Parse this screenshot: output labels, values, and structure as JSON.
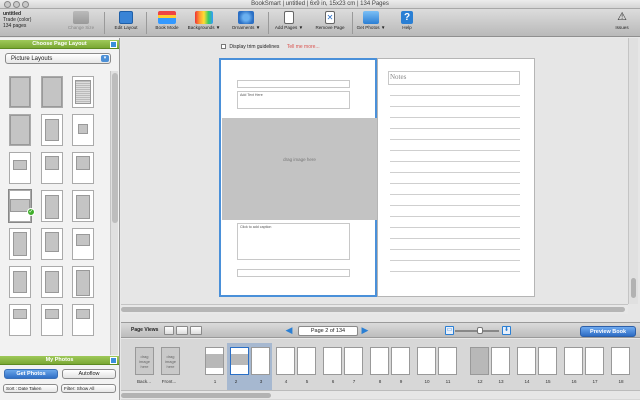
{
  "window": {
    "title": "BookSmart  |  untitled  |  6x9 in, 15x23 cm  |  134 Pages"
  },
  "project": {
    "name": "untitled",
    "cover": "Trade (color)",
    "pages": "134 pages"
  },
  "toolbar": {
    "change_size": "Change Size",
    "edit_layout": "Edit Layout",
    "book_mode": "Book Mode",
    "backgrounds": "Backgrounds ▼",
    "ornaments": "Ornaments ▼",
    "add_pages": "Add Pages ▼",
    "remove_page": "Remove Page",
    "get_photos": "Get Photos ▼",
    "help": "Help",
    "issues": "Issues"
  },
  "left_panel": {
    "header": "Choose Page Layout",
    "layout_select": "Picture Layouts",
    "photos_header": "My Photos",
    "get_photos_btn": "Get Photos",
    "autoflow_btn": "Autoflow",
    "sort_select": "Sort : Date Taken",
    "filter_select": "Filter: Show All"
  },
  "editor": {
    "trim_label": "Display trim guidelines",
    "trim_link": "Tell me more...",
    "left_page": {
      "top_text": "Add Text Here",
      "photo_label": "drag image here",
      "caption": "Click to add caption"
    },
    "right_page": {
      "notes_title": "Notes"
    }
  },
  "pageviews": {
    "label": "Page Views",
    "page_field": "Page 2 of 134",
    "preview_button": "Preview Book"
  },
  "filmstrip": {
    "back_label": "Back...",
    "front_label": "Front...",
    "thumb_text": "drag image here",
    "page_numbers": [
      "1",
      "2",
      "3",
      "4",
      "5",
      "6",
      "7",
      "8",
      "9",
      "10",
      "11",
      "12",
      "13",
      "14",
      "15",
      "16",
      "17",
      "18"
    ]
  },
  "colors": {
    "accent_green": "#8bbd47",
    "accent_blue": "#3a7fd4",
    "selection_blue": "#4a90d9"
  }
}
